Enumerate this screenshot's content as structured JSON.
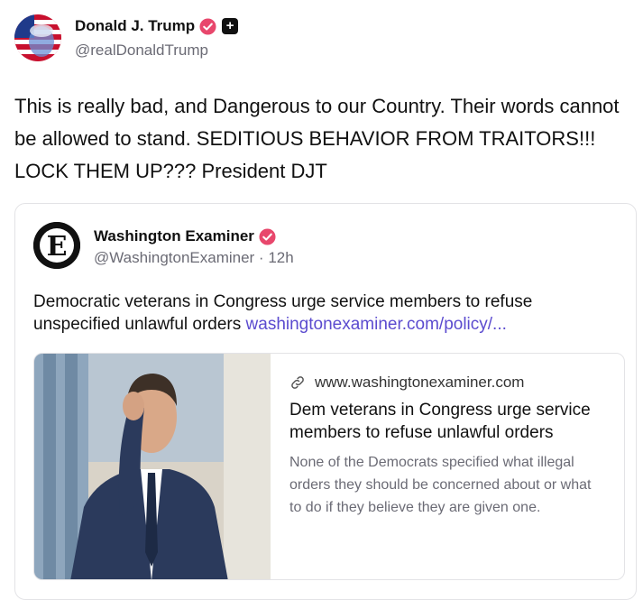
{
  "post": {
    "author_name": "Donald J. Trump",
    "handle": "@realDonaldTrump",
    "text": "This is really bad, and Dangerous to our Country. Their words cannot be allowed to stand. SEDITIOUS BEHAVIOR FROM TRAITORS!!! LOCK THEM UP??? President DJT",
    "plus_badge": "+"
  },
  "quote": {
    "author_name": "Washington Examiner",
    "handle": "@WashingtonExaminer",
    "separator": " · ",
    "time": "12h",
    "text": "Democratic veterans in Congress urge service members to refuse unspecified unlawful orders",
    "inline_link": "washingtonexaminer.com/policy/...",
    "avatar_letter": "E"
  },
  "link_card": {
    "domain": "www.washingtonexaminer.com",
    "title": "Dem veterans in Congress urge service members to refuse unlawful orders",
    "description": "None of the Democrats specified what illegal orders they should be concerned about or what to do if they believe they are given one."
  },
  "colors": {
    "verified": "#e8476c",
    "link": "#5b4bcf",
    "muted": "#6b6b75"
  },
  "icons": {
    "verified": "verified-badge-icon",
    "plus": "plus-badge-icon",
    "link": "link-chain-icon"
  }
}
